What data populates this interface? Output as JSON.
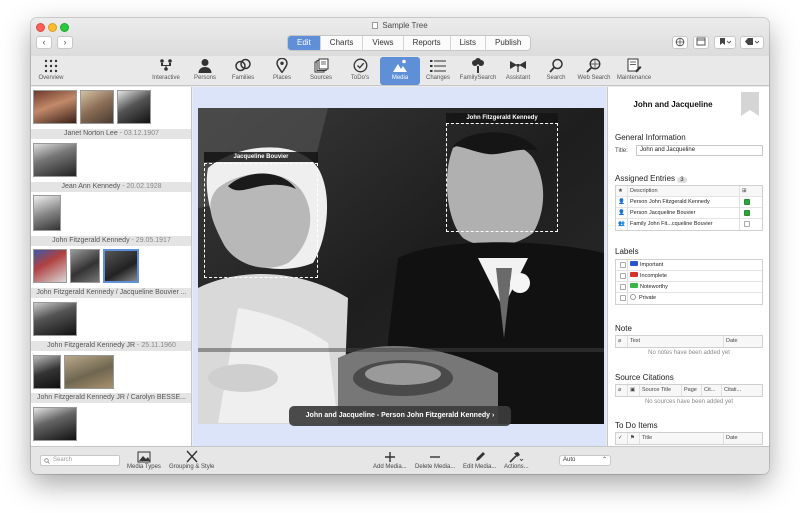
{
  "window": {
    "title": "Sample Tree"
  },
  "nav": {
    "back": "‹",
    "forward": "›"
  },
  "tabs": [
    "Edit",
    "Charts",
    "Views",
    "Reports",
    "Lists",
    "Publish"
  ],
  "toolbar": {
    "overview": "Overview",
    "items": [
      "Interactive",
      "Persons",
      "Families",
      "Places",
      "Sources",
      "ToDo's",
      "Media",
      "Changes",
      "FamilySearch",
      "Assistant",
      "Search",
      "Web Search",
      "Maintenance"
    ]
  },
  "sidebar": {
    "groups": [
      {
        "name": "Janet Norton Lee",
        "date": "- 03.12.1907"
      },
      {
        "name": "Jean Ann Kennedy",
        "date": "- 20.02.1928"
      },
      {
        "name": "John Fitzgerald Kennedy",
        "date": "- 29.05.1917"
      },
      {
        "name": "John Fitzgerald Kennedy / Jacqueline Bouvier ...",
        "date": ""
      },
      {
        "name": "John Fitzgerald Kennedy JR",
        "date": "- 25.11.1960"
      },
      {
        "name": "John Fitzgerald Kennedy JR / Carolyn BESSE...",
        "date": ""
      }
    ]
  },
  "photo": {
    "tag1": "Jacqueline Bouvier",
    "tag2": "John Fitzgerald Kennedy",
    "caption": "John and Jacqueline - Person John Fitzgerald Kennedy"
  },
  "inspector": {
    "title": "John and Jacqueline",
    "general_header": "General Information",
    "title_label": "Title:",
    "title_value": "John and Jacqueline",
    "assigned_header": "Assigned Entries",
    "assigned_count": "3",
    "assigned_col": "Description",
    "assigned": [
      {
        "text": "Person John Fitzgerald Kennedy",
        "checked": true
      },
      {
        "text": "Person Jacqueline Bouvier",
        "checked": true
      },
      {
        "text": "Family John Fit...cqueline Bouvier",
        "checked": false
      }
    ],
    "labels_header": "Labels",
    "labels": [
      {
        "text": "Important",
        "color": "#2a55d0"
      },
      {
        "text": "Incomplete",
        "color": "#d83030"
      },
      {
        "text": "Noteworthy",
        "color": "#3ab54a"
      },
      {
        "text": "Private",
        "color": "#9a9a9a"
      }
    ],
    "note_header": "Note",
    "note_cols": [
      "Text",
      "Date"
    ],
    "note_empty": "No notes have been added yet",
    "sources_header": "Source Citations",
    "sources_cols": [
      "Source Title",
      "Page",
      "Cit...",
      "Citati..."
    ],
    "sources_empty": "No sources have been added yet",
    "todo_header": "To Do Items",
    "todo_cols": [
      "Title",
      "Date"
    ]
  },
  "bottom": {
    "search_placeholder": "Search",
    "media_types": "Media Types",
    "grouping": "Grouping & Style",
    "add": "Add Media...",
    "delete": "Delete Media...",
    "edit": "Edit Media...",
    "actions": "Actions...",
    "zoom": "Auto"
  }
}
